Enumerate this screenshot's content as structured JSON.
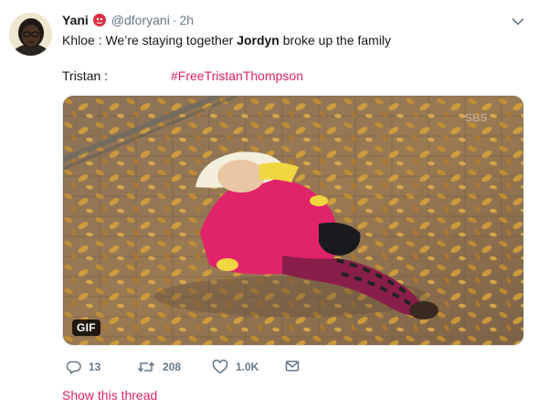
{
  "user": {
    "display_name": "Yani",
    "handle": "@dforyani",
    "separator": "·",
    "timestamp": "2h",
    "badge_icon": "red-circle-emoji-icon"
  },
  "tweet": {
    "line1_prefix": "Khloe : We’re staying together ",
    "line1_bold": "Jordyn",
    "line1_suffix": " broke up the family",
    "line2_label": "Tristan :",
    "hashtag": "#FreeTristanThompson",
    "media_badge": "GIF"
  },
  "actions": {
    "replies": "13",
    "retweets": "208",
    "likes": "1.0K"
  },
  "footer": {
    "show_thread": "Show this thread"
  },
  "colors": {
    "accent": "#e0245e",
    "muted": "#657786",
    "text": "#14171a"
  }
}
